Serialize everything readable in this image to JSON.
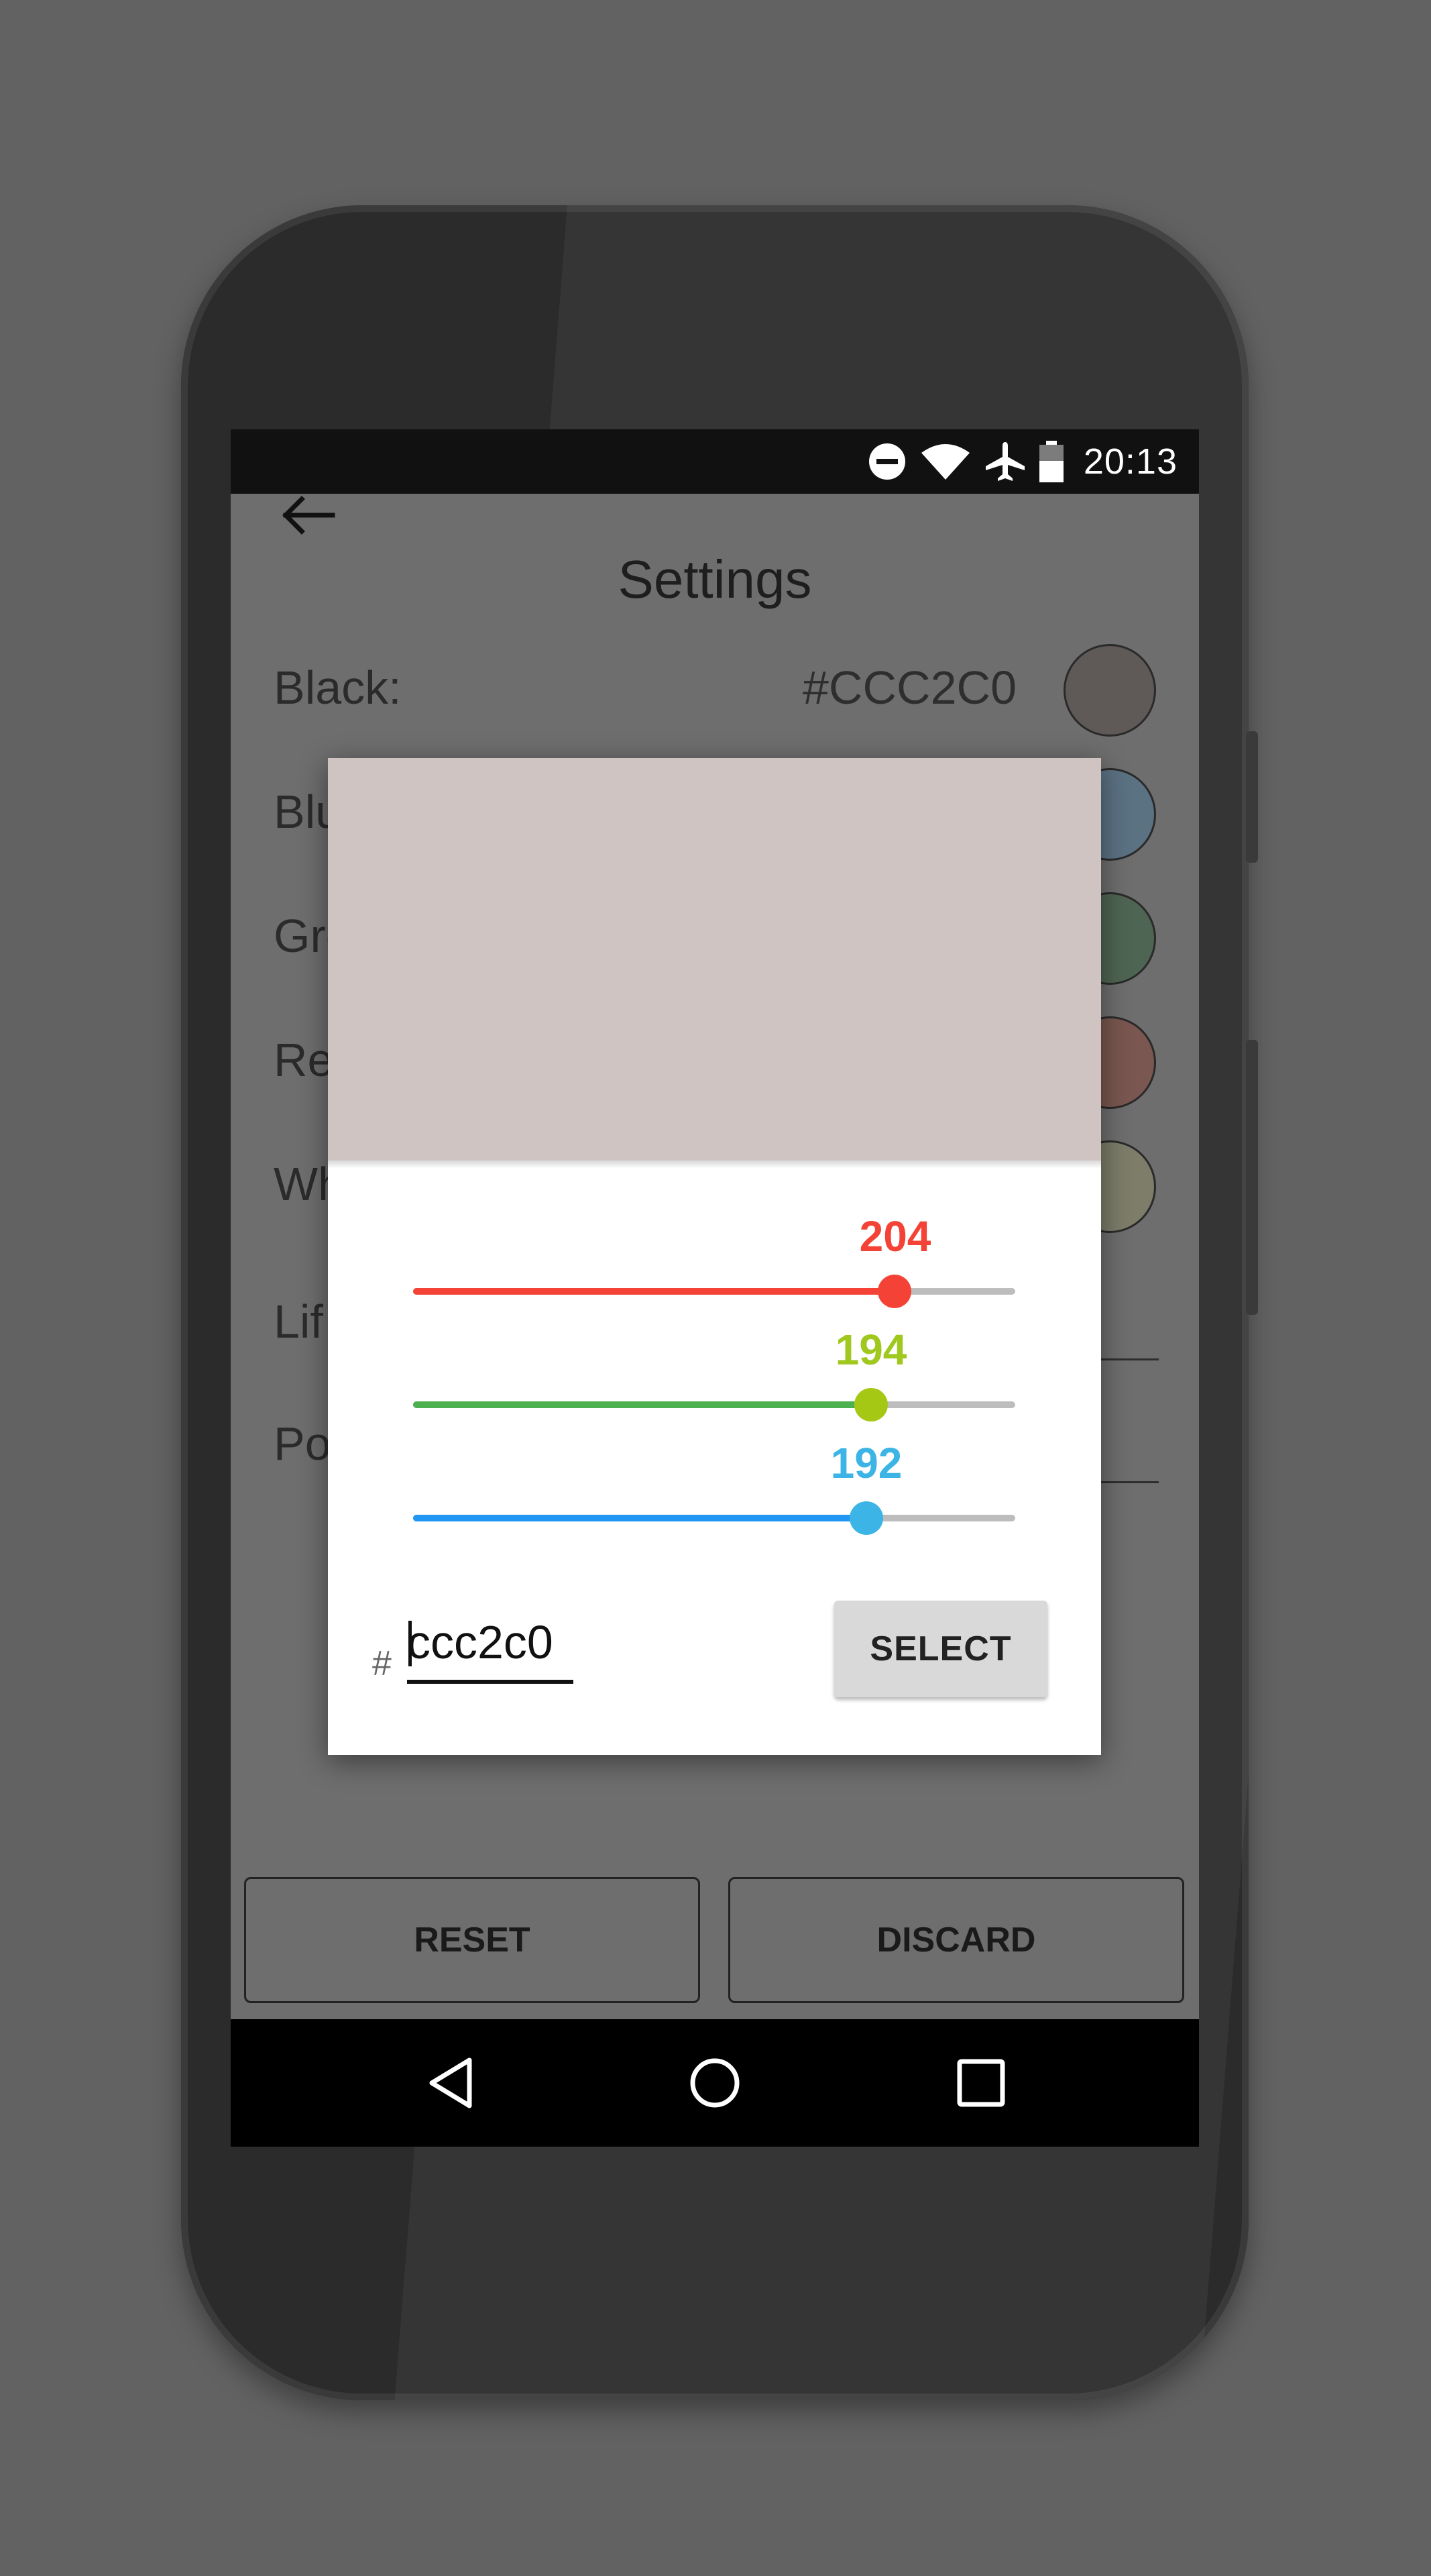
{
  "statusbar": {
    "time": "20:13",
    "icons": [
      "do-not-disturb-icon",
      "wifi-icon",
      "airplane-mode-icon",
      "battery-icon"
    ]
  },
  "toolbar": {
    "title": "Settings",
    "back_icon": "arrow-left-icon"
  },
  "settings": {
    "rows": [
      {
        "label": "Black:",
        "value": "#CCC2C0",
        "swatch_color": "#5f5958"
      },
      {
        "label": "Blu",
        "value": "",
        "swatch_color": "#5b7283"
      },
      {
        "label": "Gre",
        "value": "",
        "swatch_color": "#4f6553"
      },
      {
        "label": "Re",
        "value": "",
        "swatch_color": "#7a5750"
      },
      {
        "label": "Wh",
        "value": "",
        "swatch_color": "#7d7d6a"
      }
    ],
    "fields": [
      {
        "label": "Lif"
      },
      {
        "label": "Po"
      }
    ]
  },
  "buttons": {
    "reset": "RESET",
    "discard": "DISCARD"
  },
  "navbar": {
    "icons": [
      "back-triangle-icon",
      "home-circle-icon",
      "recents-square-icon"
    ]
  },
  "dialog": {
    "preview_color": "#cfc4c2",
    "sliders": [
      {
        "channel": "red",
        "value": "204",
        "fraction": 0.8,
        "color": "#f44336"
      },
      {
        "channel": "green",
        "value": "194",
        "fraction": 0.761,
        "color": "#4caf50",
        "label_color": "#a0c81e",
        "thumb_color": "#a5c814"
      },
      {
        "channel": "blue",
        "value": "192",
        "fraction": 0.753,
        "color": "#2196f3",
        "label_color": "#3cb4e6",
        "thumb_color": "#3cb4e6"
      }
    ],
    "hash": "#",
    "hex_value": "ccc2c0",
    "select_label": "SELECT"
  }
}
